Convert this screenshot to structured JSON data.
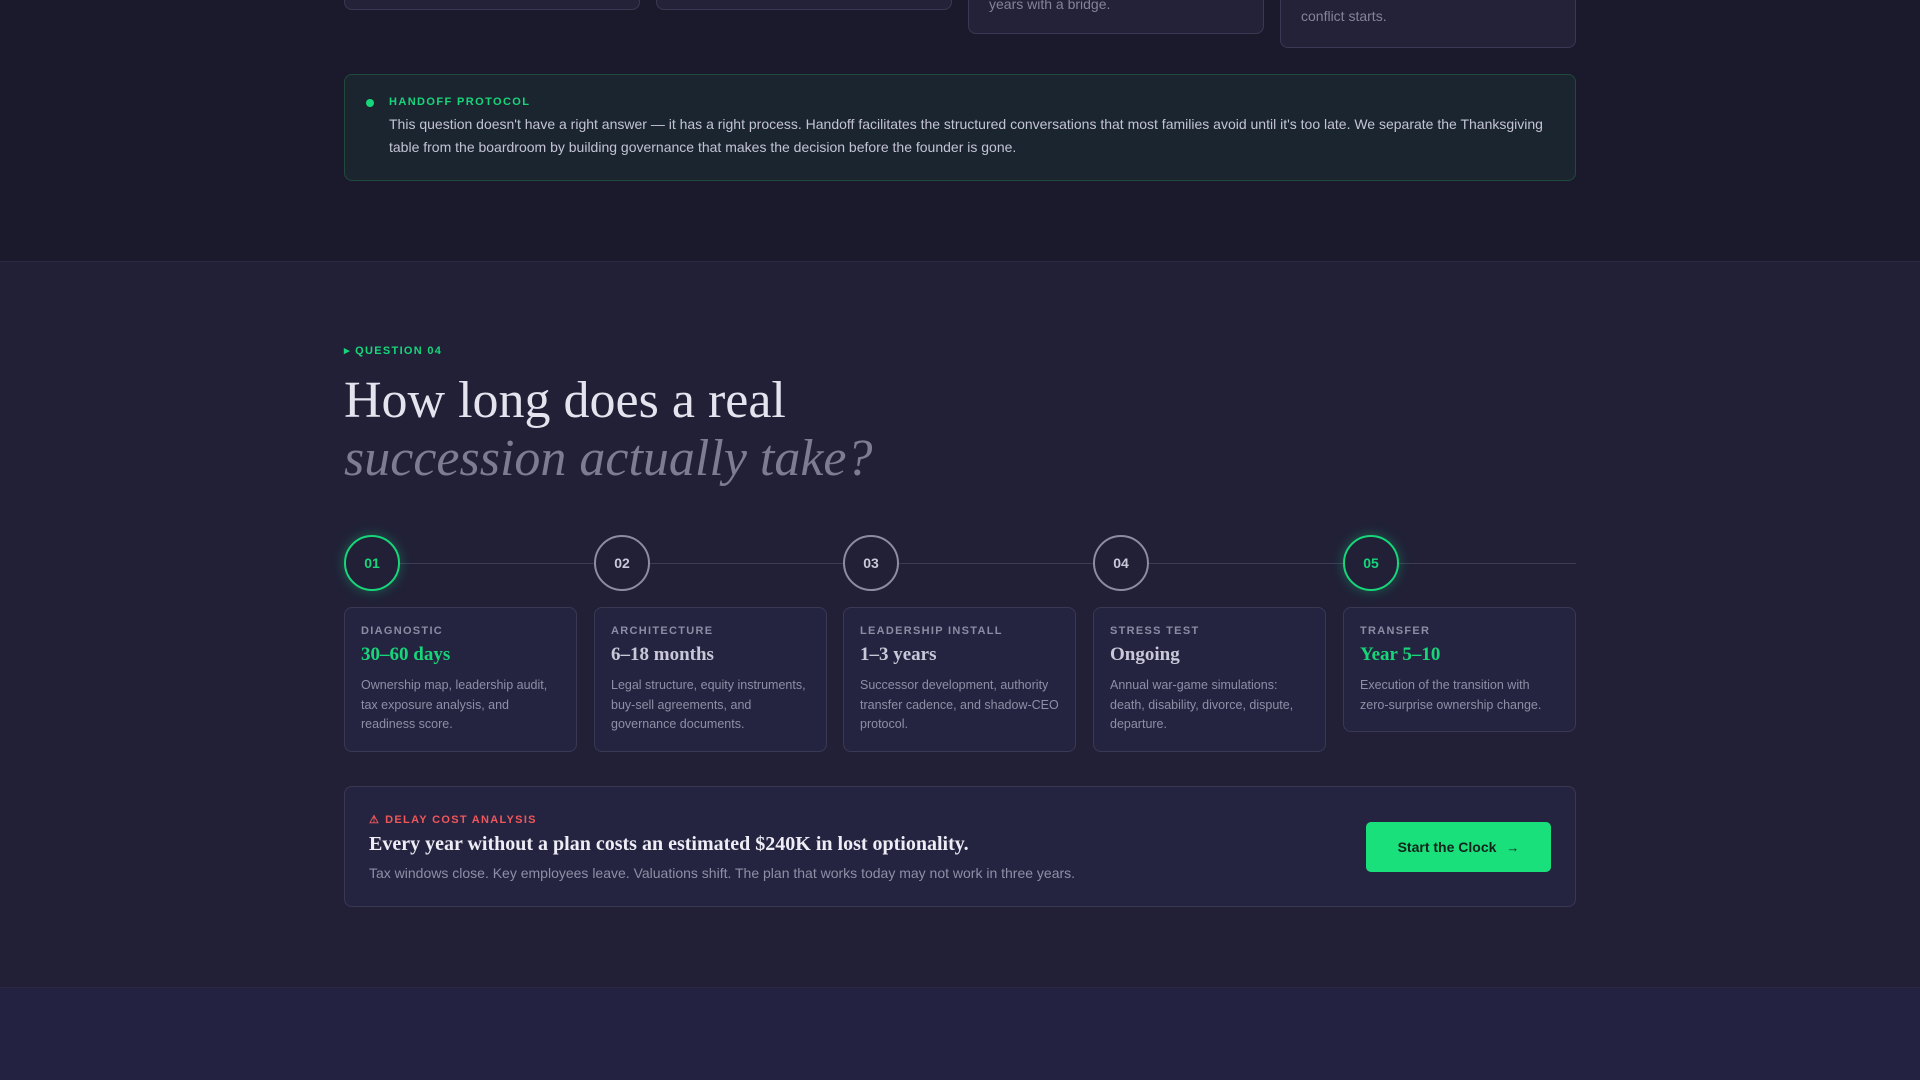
{
  "previous_section": {
    "card_fragments": [
      {
        "text": ""
      },
      {
        "text": ""
      },
      {
        "text": "years with a bridge."
      },
      {
        "text": "conflict starts."
      }
    ],
    "protocol": {
      "eyebrow": "HANDOFF PROTOCOL",
      "text": "This question doesn't have a right answer — it has a right process. Handoff facilitates the structured conversations that most families avoid until it's too late. We separate the Thanksgiving table from the boardroom by building governance that makes the decision before the founder is gone."
    }
  },
  "question": {
    "eyebrow": "▸ QUESTION 04",
    "title_line1": "How long does a real",
    "title_line2": "succession actually take?",
    "steps": [
      {
        "number": "01",
        "label": "DIAGNOSTIC",
        "duration": "30–60 days",
        "description": "Ownership map, leadership audit, tax exposure analysis, and readiness score.",
        "highlighted": true
      },
      {
        "number": "02",
        "label": "ARCHITECTURE",
        "duration": "6–18 months",
        "description": "Legal structure, equity instruments, buy-sell agreements, and governance documents.",
        "highlighted": false
      },
      {
        "number": "03",
        "label": "LEADERSHIP INSTALL",
        "duration": "1–3 years",
        "description": "Successor development, authority transfer cadence, and shadow-CEO protocol.",
        "highlighted": false
      },
      {
        "number": "04",
        "label": "STRESS TEST",
        "duration": "Ongoing",
        "description": "Annual war-game simulations: death, disability, divorce, dispute, departure.",
        "highlighted": false
      },
      {
        "number": "05",
        "label": "TRANSFER",
        "duration": "Year 5–10",
        "description": "Execution of the transition with zero-surprise ownership change.",
        "highlighted": true
      }
    ],
    "delay": {
      "warn_icon": "⚠",
      "eyebrow": "DELAY COST ANALYSIS",
      "headline": "Every year without a plan costs an estimated $240K in lost optionality.",
      "subtext": "Tax windows close. Key employees leave. Valuations shift. The plan that works today may not work in three years.",
      "cta_label": "Start the Clock",
      "cta_icon": "→"
    }
  },
  "colors": {
    "accent": "#17d67a",
    "warning": "#f0565a",
    "background": "#1b1a2c",
    "section_background": "#212037"
  }
}
